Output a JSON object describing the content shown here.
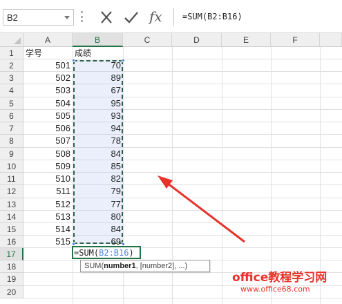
{
  "formula_bar": {
    "name_box": "B2",
    "formula": "=SUM(B2:B16)",
    "cancel_icon": "close-icon",
    "enter_icon": "check-icon",
    "function_label": "fx"
  },
  "columns": [
    "A",
    "B",
    "C",
    "D",
    "E",
    "F"
  ],
  "rows": [
    "1",
    "2",
    "3",
    "4",
    "5",
    "6",
    "7",
    "8",
    "9",
    "10",
    "11",
    "12",
    "13",
    "14",
    "15",
    "16",
    "17",
    "18",
    "19",
    "20"
  ],
  "headers": {
    "a1": "学号",
    "b1": "成绩"
  },
  "table": [
    {
      "id": "501",
      "score": "70"
    },
    {
      "id": "502",
      "score": "89"
    },
    {
      "id": "503",
      "score": "67"
    },
    {
      "id": "504",
      "score": "95"
    },
    {
      "id": "505",
      "score": "93"
    },
    {
      "id": "506",
      "score": "94"
    },
    {
      "id": "507",
      "score": "78"
    },
    {
      "id": "508",
      "score": "84"
    },
    {
      "id": "509",
      "score": "85"
    },
    {
      "id": "510",
      "score": "82"
    },
    {
      "id": "511",
      "score": "79"
    },
    {
      "id": "512",
      "score": "77"
    },
    {
      "id": "513",
      "score": "80"
    },
    {
      "id": "514",
      "score": "84"
    },
    {
      "id": "515",
      "score": "69"
    }
  ],
  "edit_cell": {
    "prefix": "=SUM(",
    "ref": "B2:B16",
    "suffix": ")"
  },
  "tooltip": {
    "fn": "SUM(",
    "arg1": "number1",
    "rest": ", [number2], ...)"
  },
  "watermark": {
    "line1": "office教程学习网",
    "line2": "www.office68.com"
  },
  "colors": {
    "selection_green": "#217346",
    "ref_blue": "#4a86d8",
    "arrow_red": "#e8322b"
  }
}
